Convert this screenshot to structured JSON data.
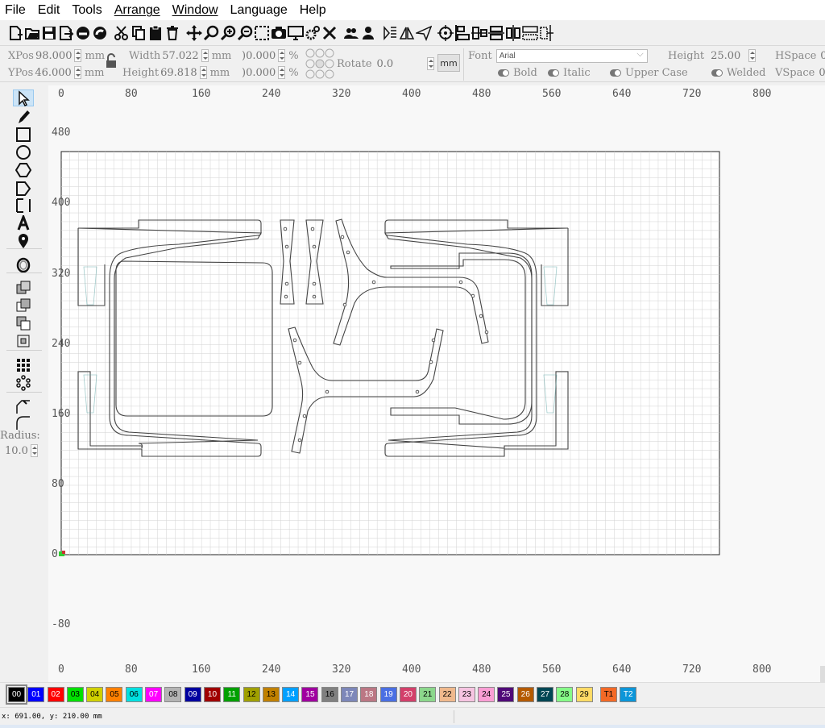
{
  "menu": [
    "File",
    "Edit",
    "Tools",
    "Arrange",
    "Window",
    "Language",
    "Help"
  ],
  "toolbar_icons": [
    "new-file-icon",
    "open-folder-icon",
    "save-icon",
    "export-icon",
    "import-icon",
    "circle-fill-icon",
    "cut-icon",
    "copy-icon",
    "clipboard-icon",
    "trash-icon",
    "move-icon",
    "zoom-fit-icon",
    "zoom-in-icon",
    "zoom-out-icon",
    "select-rect-icon",
    "camera-icon",
    "monitor-icon",
    "settings-icon",
    "tools-icon",
    "users-icon",
    "user-icon",
    "mirror-h-icon",
    "mirror-v-icon",
    "send-icon",
    "target-icon",
    "align-left-icon",
    "align-center-icon",
    "distribute-h-icon",
    "distribute-v-icon",
    "grid-icon",
    "center-icon"
  ],
  "props": {
    "xpos_label": "XPos",
    "xpos_value": "98.000",
    "xpos_unit": "mm",
    "ypos_label": "YPos",
    "ypos_value": "46.000",
    "ypos_unit": "mm",
    "width_label": "Width",
    "width_value": "57.022",
    "width_unit": "mm",
    "height_label": "Height",
    "height_value": "69.818",
    "height_unit": "mm",
    "scale_x": ")0.000",
    "scale_y": ")0.000",
    "pct": "%",
    "rotate_label": "Rotate",
    "rotate_value": "0.0",
    "mm_button": "mm",
    "font_label": "Font",
    "font_value": "Arial",
    "text_height_label": "Height",
    "text_height_value": "25.00",
    "hspace_label": "HSpace",
    "hspace_value": "0.",
    "vspace_label": "VSpace",
    "vspace_value": "0.",
    "bold": "Bold",
    "italic": "Italic",
    "upper_case": "Upper Case",
    "welded": "Welded"
  },
  "left_tools": [
    "cursor-icon",
    "pencil-icon",
    "rectangle-icon",
    "ellipse-icon",
    "polygon-icon",
    "pentagon-icon",
    "line-icon",
    "text-icon",
    "pin-icon",
    "offset-icon",
    "union-icon",
    "subtract-icon",
    "intersect-icon",
    "copy-icon",
    "array-icon",
    "circle-array-icon",
    "rounded-corner-icon",
    "fillet-icon"
  ],
  "radius": {
    "label": "Radius:",
    "value": "10.0"
  },
  "ruler": {
    "top": [
      "0",
      "80",
      "160",
      "240",
      "320",
      "400",
      "480",
      "560",
      "640",
      "720",
      "800"
    ],
    "left": [
      "480",
      "400",
      "320",
      "240",
      "160",
      "80",
      "0",
      "-80"
    ],
    "bottom": [
      "0",
      "80",
      "160",
      "240",
      "320",
      "400",
      "480",
      "560",
      "640",
      "720",
      "800"
    ]
  },
  "palette": [
    {
      "label": "00",
      "color": "#000000",
      "text": "#ffffff"
    },
    {
      "label": "01",
      "color": "#0000ff",
      "text": "#ffffff"
    },
    {
      "label": "02",
      "color": "#ff0000",
      "text": "#ffffff"
    },
    {
      "label": "03",
      "color": "#00e000",
      "text": "#000000"
    },
    {
      "label": "04",
      "color": "#d0d000",
      "text": "#000000"
    },
    {
      "label": "05",
      "color": "#ff8000",
      "text": "#000000"
    },
    {
      "label": "06",
      "color": "#00e0e0",
      "text": "#000000"
    },
    {
      "label": "07",
      "color": "#ff00ff",
      "text": "#ffffff"
    },
    {
      "label": "08",
      "color": "#b4b4b4",
      "text": "#000000"
    },
    {
      "label": "09",
      "color": "#0000a0",
      "text": "#ffffff"
    },
    {
      "label": "10",
      "color": "#a00000",
      "text": "#ffffff"
    },
    {
      "label": "11",
      "color": "#00a000",
      "text": "#ffffff"
    },
    {
      "label": "12",
      "color": "#a0a000",
      "text": "#000000"
    },
    {
      "label": "13",
      "color": "#c08000",
      "text": "#000000"
    },
    {
      "label": "14",
      "color": "#00a0ff",
      "text": "#ffffff"
    },
    {
      "label": "15",
      "color": "#a000a0",
      "text": "#ffffff"
    },
    {
      "label": "16",
      "color": "#808080",
      "text": "#000000"
    },
    {
      "label": "17",
      "color": "#7d87b9",
      "text": "#ffffff"
    },
    {
      "label": "18",
      "color": "#bb7784",
      "text": "#ffffff"
    },
    {
      "label": "19",
      "color": "#4a6fe3",
      "text": "#ffffff"
    },
    {
      "label": "20",
      "color": "#d33f6a",
      "text": "#ffffff"
    },
    {
      "label": "21",
      "color": "#8cd78c",
      "text": "#000000"
    },
    {
      "label": "22",
      "color": "#f0b98d",
      "text": "#000000"
    },
    {
      "label": "23",
      "color": "#f6c4e1",
      "text": "#000000"
    },
    {
      "label": "24",
      "color": "#fa9ed4",
      "text": "#000000"
    },
    {
      "label": "25",
      "color": "#500a78",
      "text": "#ffffff"
    },
    {
      "label": "26",
      "color": "#b45a00",
      "text": "#ffffff"
    },
    {
      "label": "27",
      "color": "#004754",
      "text": "#ffffff"
    },
    {
      "label": "28",
      "color": "#86fa88",
      "text": "#000000"
    },
    {
      "label": "29",
      "color": "#ffdb66",
      "text": "#000000"
    },
    {
      "label": "T1",
      "color": "#f36926",
      "text": "#000000"
    },
    {
      "label": "T2",
      "color": "#0c96d9",
      "text": "#ffffff"
    }
  ],
  "status": {
    "coords": "x: 691.00, y: 210.00 mm"
  }
}
